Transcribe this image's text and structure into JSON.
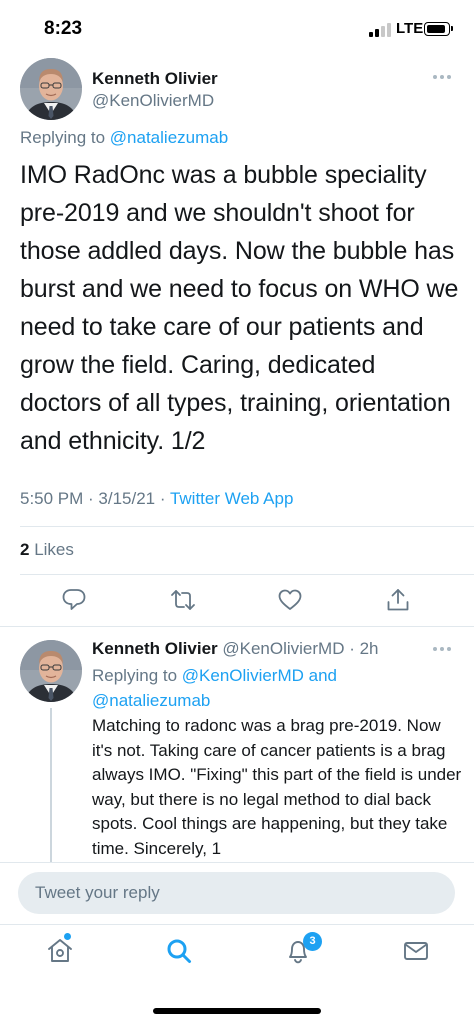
{
  "status_bar": {
    "time": "8:23",
    "network": "LTE",
    "signal_bars_filled": 2,
    "signal_bars_total": 4,
    "battery_level": 0.9
  },
  "main_tweet": {
    "author_name": "Kenneth Olivier",
    "author_handle": "@KenOlivierMD",
    "replying_prefix": "Replying to",
    "replying_mention": "@nataliezumab",
    "text": "IMO RadOnc was a bubble speciality pre-2019 and we shouldn't shoot for those addled days. Now the bubble has burst and we need to focus on WHO we need to take care of our patients and grow the field. Caring, dedicated doctors of all types, training, orientation and ethnicity. 1/2",
    "timestamp": "5:50 PM · 3/15/21 · ",
    "app": "Twitter Web App",
    "likes_count": "2",
    "likes_label": " Likes"
  },
  "reply_tweet": {
    "author_name": "Kenneth Olivier",
    "author_handle": "@KenOlivierMD · 2h",
    "replying_prefix": "Replying to ",
    "replying_mention_1": "@KenOlivierMD",
    "replying_joiner": " and",
    "replying_mention_2": "@nataliezumab",
    "text": "Matching to radonc was a brag pre-2019. Now it's not. Taking care of cancer patients is a brag always IMO. \"Fixing\" this part of the field is under way, but there is no legal method to dial back spots. Cool things are happening, but they take time. Sincerely, 1"
  },
  "composer": {
    "placeholder": "Tweet your reply"
  },
  "tab_bar": {
    "notifications_badge": "3"
  },
  "icons": {
    "reply": "speech-bubble",
    "retweet": "retweet-arrows",
    "like": "heart",
    "share": "share-arrow",
    "more": "ellipsis",
    "home": "home",
    "search": "magnifier",
    "notifications": "bell",
    "messages": "envelope"
  },
  "colors": {
    "accent": "#1da1f2",
    "muted_text": "#657786",
    "primary_text": "#14171a",
    "divider": "#e1e8ed",
    "composer_bg": "#e6ecf0"
  }
}
